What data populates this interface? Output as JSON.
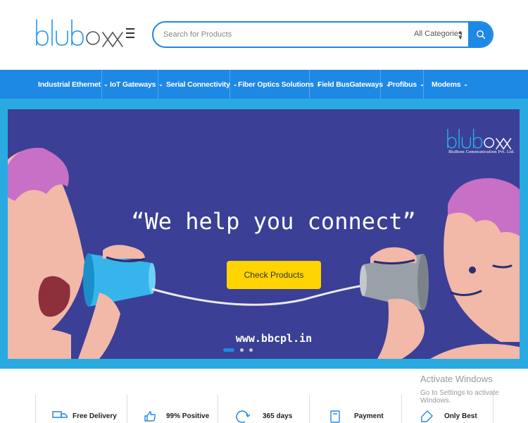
{
  "header": {
    "logo_alt": "bluboxx",
    "search": {
      "placeholder": "Search for Products",
      "category": "All Categories"
    }
  },
  "nav": {
    "items": [
      {
        "label": "Industrial Ethernet"
      },
      {
        "label": "IoT Gateways"
      },
      {
        "label": "Serial Connectivity"
      },
      {
        "label": "Fiber Optics Solutions"
      },
      {
        "label": "Field BusGateways"
      },
      {
        "label": "Profibus"
      },
      {
        "label": "Modems"
      }
    ]
  },
  "banner": {
    "headline": "“We help you connect”",
    "cta_label": "Check Products",
    "url": "www.bbcpl.in",
    "logo_subtitle": "BluBoxx Communication Pvt. Ltd.",
    "slides": 3,
    "active_slide": 1
  },
  "features": [
    {
      "label": "Free Delivery",
      "icon": "truck-icon"
    },
    {
      "label": "99% Positive",
      "icon": "thumbs-up-icon"
    },
    {
      "label": "365 days",
      "icon": "refresh-icon"
    },
    {
      "label": "Payment",
      "icon": "card-icon"
    },
    {
      "label": "Only Best",
      "icon": "tag-icon"
    }
  ],
  "watermark": {
    "title": "Activate Windows",
    "subtitle": "Go to Settings to activate Windows."
  },
  "colors": {
    "brand_blue": "#1e88e5",
    "banner_bg": "#3b3f96",
    "banner_frame": "#29abe2",
    "cta": "#ffd400"
  }
}
